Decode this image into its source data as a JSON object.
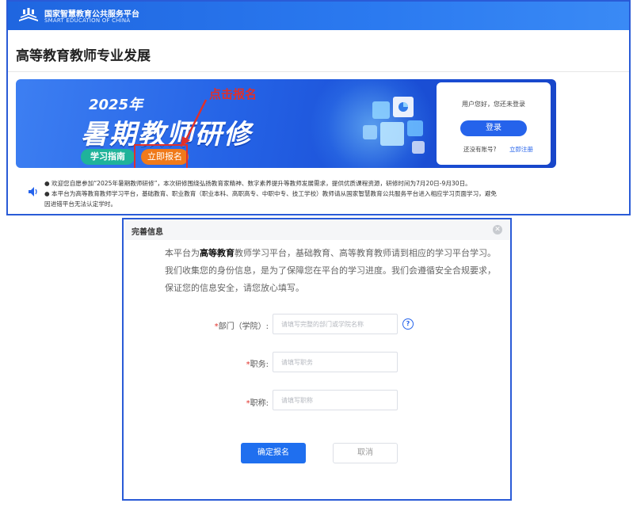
{
  "header": {
    "logo_cn": "国家智慧教育公共服务平台",
    "logo_en": "SMART EDUCATION OF CHINA"
  },
  "page": {
    "title": "高等教育教师专业发展"
  },
  "banner": {
    "year": "2025年",
    "headline": "暑期教师研修",
    "guide_label": "学习指南",
    "signup_label": "立即报名",
    "annotation": "点击报名",
    "annotation_color": "#e0302a"
  },
  "login_card": {
    "greeting": "用户您好，您还未登录",
    "login_label": "登录",
    "no_account": "还没有账号?",
    "register_label": "立即注册"
  },
  "notices": [
    "● 欢迎您自愿参加“2025年暑期教师研修”，本次研修围绕弘扬教育家精神、数字素养提升等教师发展需求，提供优质课程资源，研修时间为7月20日-9月30日。",
    "● 本平台为高等教育教师学习平台，基础教育、职业教育（职业本科、高职高专、中职中专、技工学校）教师请从国家智慧教育公共服务平台进入相应学习页面学习，避免",
    "因进错平台无法认定学时。"
  ],
  "dialog": {
    "title": "完善信息",
    "intro_prefix": "本平台为",
    "intro_bold": "高等教育",
    "intro_rest": "教师学习平台，基础教育、高等教育教师请到相应的学习平台学习。我们收集您的身份信息，是为了保障您在平台的学习进度。我们会遵循安全合规要求，保证您的信息安全，请您放心填写。",
    "fields": {
      "dept": {
        "label": "部门（学院）:",
        "placeholder": "请填写完整的部门或学院名称",
        "value": ""
      },
      "position": {
        "label": "职务:",
        "placeholder": "请填写职务",
        "value": ""
      },
      "title": {
        "label": "职称:",
        "placeholder": "请填写职称",
        "value": ""
      }
    },
    "required_mark": "*",
    "confirm_label": "确定报名",
    "cancel_label": "取消"
  },
  "colors": {
    "brand_blue": "#2563eb",
    "frame_blue": "#2a5bd7",
    "signup_orange": "#f07a1a",
    "guide_green": "#1fb39a"
  },
  "icons": [
    "logo-book-icon",
    "speaker-icon",
    "close-icon",
    "help-icon",
    "arrow-icon"
  ]
}
